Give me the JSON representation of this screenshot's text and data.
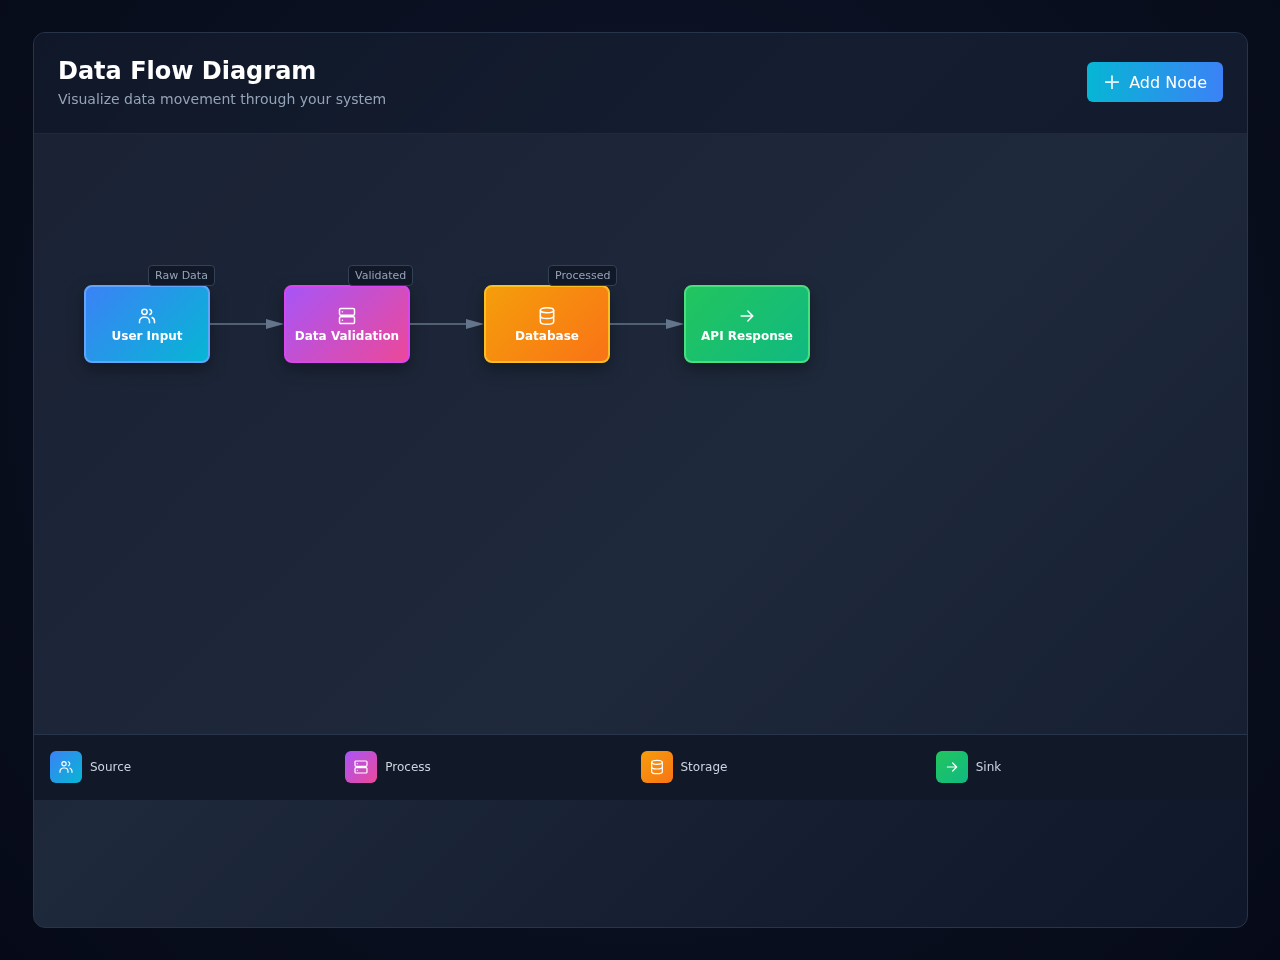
{
  "header": {
    "title": "Data Flow Diagram",
    "subtitle": "Visualize data movement through your system",
    "add_button": {
      "label": "Add Node",
      "icon": "+"
    }
  },
  "nodes": [
    {
      "label": "User Input",
      "kind": "source"
    },
    {
      "label": "Data Validation",
      "kind": "process"
    },
    {
      "label": "Database",
      "kind": "storage"
    },
    {
      "label": "API Response",
      "kind": "sink"
    }
  ],
  "edges": [
    {
      "label": "Raw Data"
    },
    {
      "label": "Validated"
    },
    {
      "label": "Processed"
    }
  ],
  "legend": [
    {
      "label": "Source",
      "kind": "source"
    },
    {
      "label": "Process",
      "kind": "process"
    },
    {
      "label": "Storage",
      "kind": "storage"
    },
    {
      "label": "Sink",
      "kind": "sink"
    }
  ]
}
